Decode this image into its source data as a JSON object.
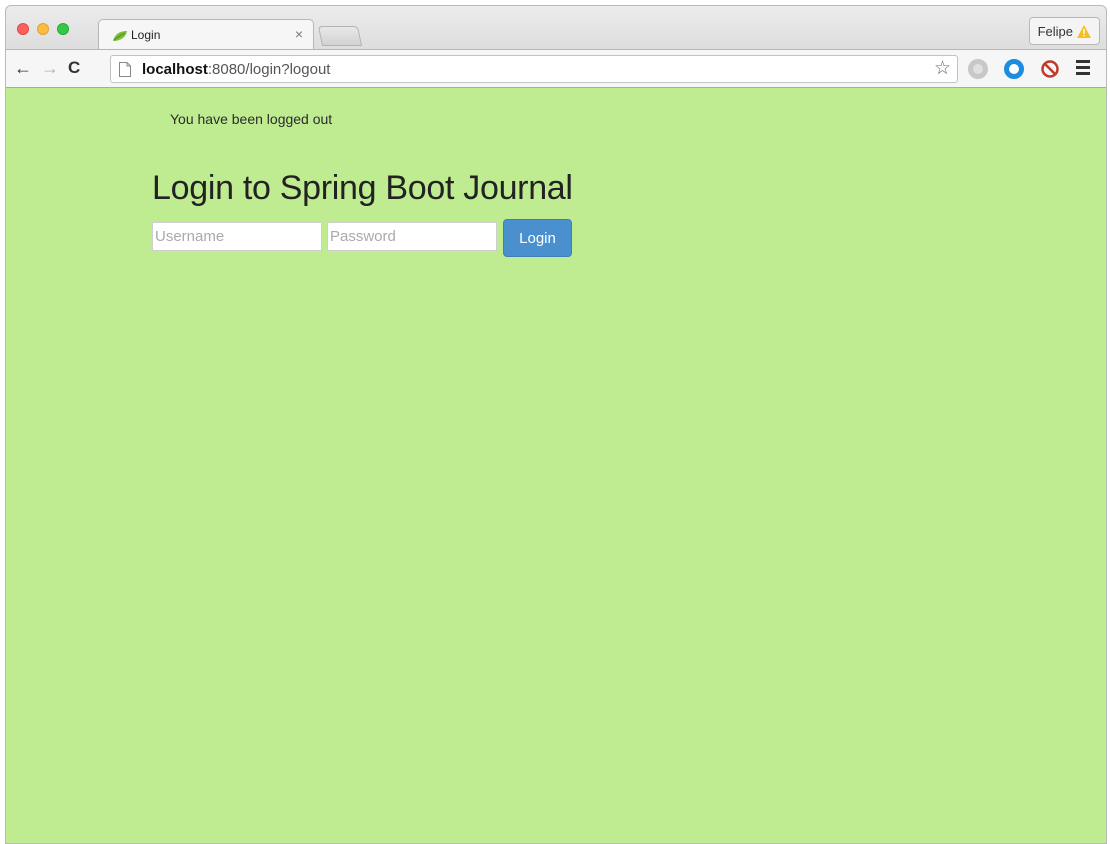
{
  "browser": {
    "tab": {
      "title": "Login",
      "close_symbol": "×",
      "favicon": "spring-leaf-icon"
    },
    "profile": {
      "name": "Felipe",
      "icon": "warning-icon"
    },
    "toolbar": {
      "back_symbol": "←",
      "forward_symbol": "→",
      "reload_symbol": "C",
      "url_host": "localhost",
      "url_rest": ":8080/login?logout",
      "bookmark_symbol": "☆"
    },
    "colors": {
      "page_background": "#bfec91",
      "button": "#4a90cf"
    }
  },
  "page": {
    "logout_message": "You have been logged out",
    "heading": "Login to Spring Boot Journal",
    "username_placeholder": "Username",
    "password_placeholder": "Password",
    "login_label": "Login"
  }
}
